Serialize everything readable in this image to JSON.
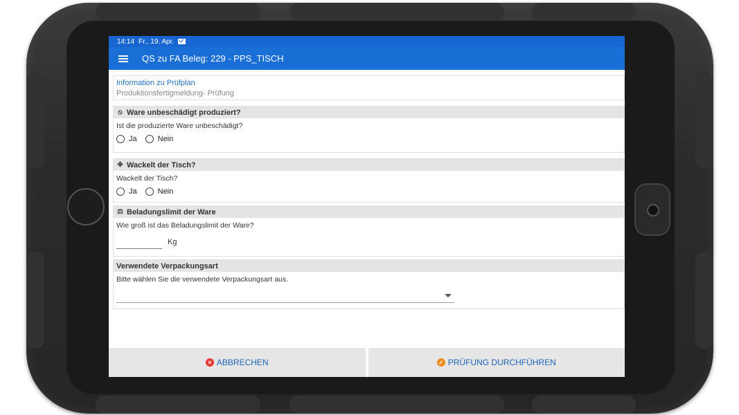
{
  "status": {
    "time": "14:14",
    "date": "Fr., 19. Apr."
  },
  "appbar": {
    "title": "QS zu FA Beleg: 229 - PPS_TISCH"
  },
  "info": {
    "title": "Information zu Prüfplan",
    "text": "Produktionsfertigmeldung- Prüfung"
  },
  "sections": [
    {
      "header": "Ware unbeschädigt produziert?",
      "icon": "ban-icon",
      "question": "Ist die produzierte Ware unbeschädigt?",
      "options": [
        "Ja",
        "Nein"
      ]
    },
    {
      "header": "Wackelt der Tisch?",
      "icon": "move-icon",
      "question": "Wackelt der Tisch?",
      "options": [
        "Ja",
        "Nein"
      ]
    },
    {
      "header": "Beladungslimit der Ware",
      "icon": "scale-icon",
      "question": "Wie groß ist das Beladungslimit der Ware?",
      "input_value": "",
      "unit": "Kg"
    },
    {
      "header": "Verwendete Verpackungsart",
      "question": "Bitte wählen Sie die verwendete Verpackungsart aus.",
      "selected": ""
    }
  ],
  "footer": {
    "cancel_label": "ABBRECHEN",
    "submit_label": "PRÜFUNG DURCHFÜHREN"
  },
  "colors": {
    "appbar": "#1a6fd6",
    "accent_text": "#1f6fc5",
    "cancel": "#e53935",
    "submit": "#ef8b1c"
  }
}
